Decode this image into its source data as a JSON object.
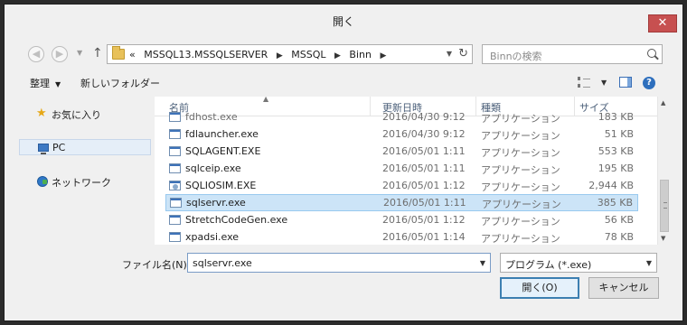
{
  "window": {
    "title": "開く",
    "close_label": "✕"
  },
  "nav": {
    "back_label": "◀",
    "forward_label": "▶",
    "dropdown_label": "▼",
    "up_label": "↑",
    "breadcrumb": {
      "prefix": "«",
      "parts": [
        "MSSQL13.MSSQLSERVER",
        "MSSQL",
        "Binn"
      ],
      "separator": "▶"
    },
    "search_placeholder": "Binnの検索"
  },
  "toolbar": {
    "organize_label": "整理",
    "new_folder_label": "新しいフォルダー",
    "help_label": "?"
  },
  "sidebar": {
    "items": [
      {
        "label": "お気に入り",
        "icon": "star-icon"
      },
      {
        "label": "PC",
        "icon": "pc-icon",
        "selected": true
      },
      {
        "label": "ネットワーク",
        "icon": "network-icon"
      }
    ]
  },
  "filelist": {
    "columns": {
      "name": "名前",
      "date": "更新日時",
      "type": "種類",
      "size": "サイズ"
    },
    "rows": [
      {
        "name": "fdhost.exe",
        "date": "2016/04/30 9:12",
        "type": "アプリケーション",
        "size": "183 KB",
        "partial": true
      },
      {
        "name": "fdlauncher.exe",
        "date": "2016/04/30 9:12",
        "type": "アプリケーション",
        "size": "51 KB"
      },
      {
        "name": "SQLAGENT.EXE",
        "date": "2016/05/01 1:11",
        "type": "アプリケーション",
        "size": "553 KB"
      },
      {
        "name": "sqlceip.exe",
        "date": "2016/05/01 1:11",
        "type": "アプリケーション",
        "size": "195 KB"
      },
      {
        "name": "SQLIOSIM.EXE",
        "date": "2016/05/01 1:12",
        "type": "アプリケーション",
        "size": "2,944 KB"
      },
      {
        "name": "sqlservr.exe",
        "date": "2016/05/01 1:11",
        "type": "アプリケーション",
        "size": "385 KB",
        "selected": true
      },
      {
        "name": "StretchCodeGen.exe",
        "date": "2016/05/01 1:12",
        "type": "アプリケーション",
        "size": "56 KB"
      },
      {
        "name": "xpadsi.exe",
        "date": "2016/05/01 1:14",
        "type": "アプリケーション",
        "size": "78 KB"
      }
    ]
  },
  "footer": {
    "filename_label": "ファイル名(N):",
    "filename_value": "sqlservr.exe",
    "filetype_value": "プログラム (*.exe)",
    "open_label": "開く(O)",
    "cancel_label": "キャンセル"
  },
  "colors": {
    "selection": "#cce4f7",
    "close_button": "#c75050",
    "header_text": "#4c607a"
  }
}
